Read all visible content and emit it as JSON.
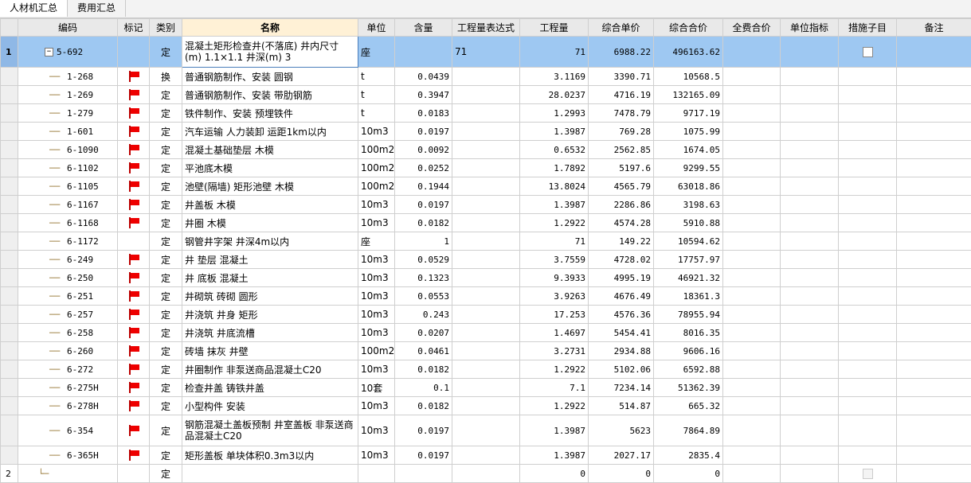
{
  "tabs": [
    "人材机汇总",
    "费用汇总"
  ],
  "headers": [
    "编码",
    "标记",
    "类别",
    "名称",
    "单位",
    "含量",
    "工程量表达式",
    "工程量",
    "综合单价",
    "综合合价",
    "全费合价",
    "单位指标",
    "措施子目",
    "备注"
  ],
  "main_row": {
    "index": "1",
    "code": "5-692",
    "type": "定",
    "name": "混凝土矩形检查井(不落底) 井内尺寸(m) 1.1×1.1 井深(m) 3",
    "unit": "座",
    "qty_expr": "71",
    "quantity": "71",
    "unit_price": "6988.22",
    "total": "496163.62"
  },
  "sub_rows": [
    {
      "code": "1-268",
      "type": "换",
      "name": "普通钢筋制作、安装 圆钢",
      "unit": "t",
      "content": "0.0439",
      "quantity": "3.1169",
      "unit_price": "3390.71",
      "total": "10568.5",
      "flag": true
    },
    {
      "code": "1-269",
      "type": "定",
      "name": "普通钢筋制作、安装 带肋钢筋",
      "unit": "t",
      "content": "0.3947",
      "quantity": "28.0237",
      "unit_price": "4716.19",
      "total": "132165.09",
      "flag": true
    },
    {
      "code": "1-279",
      "type": "定",
      "name": "铁件制作、安装 预埋铁件",
      "unit": "t",
      "content": "0.0183",
      "quantity": "1.2993",
      "unit_price": "7478.79",
      "total": "9717.19",
      "flag": true
    },
    {
      "code": "1-601",
      "type": "定",
      "name": "汽车运输 人力装卸 运距1km以内",
      "unit": "10m3",
      "content": "0.0197",
      "quantity": "1.3987",
      "unit_price": "769.28",
      "total": "1075.99",
      "flag": true
    },
    {
      "code": "6-1090",
      "type": "定",
      "name": "混凝土基础垫层 木模",
      "unit": "100m2",
      "content": "0.0092",
      "quantity": "0.6532",
      "unit_price": "2562.85",
      "total": "1674.05",
      "flag": true
    },
    {
      "code": "6-1102",
      "type": "定",
      "name": "平池底木模",
      "unit": "100m2",
      "content": "0.0252",
      "quantity": "1.7892",
      "unit_price": "5197.6",
      "total": "9299.55",
      "flag": true
    },
    {
      "code": "6-1105",
      "type": "定",
      "name": "池壁(隔墙) 矩形池壁 木模",
      "unit": "100m2",
      "content": "0.1944",
      "quantity": "13.8024",
      "unit_price": "4565.79",
      "total": "63018.86",
      "flag": true
    },
    {
      "code": "6-1167",
      "type": "定",
      "name": "井盖板 木模",
      "unit": "10m3",
      "content": "0.0197",
      "quantity": "1.3987",
      "unit_price": "2286.86",
      "total": "3198.63",
      "flag": true
    },
    {
      "code": "6-1168",
      "type": "定",
      "name": "井圈 木模",
      "unit": "10m3",
      "content": "0.0182",
      "quantity": "1.2922",
      "unit_price": "4574.28",
      "total": "5910.88",
      "flag": true
    },
    {
      "code": "6-1172",
      "type": "定",
      "name": "钢管井字架 井深4m以内",
      "unit": "座",
      "content": "1",
      "quantity": "71",
      "unit_price": "149.22",
      "total": "10594.62",
      "flag": false
    },
    {
      "code": "6-249",
      "type": "定",
      "name": "井 垫层 混凝土",
      "unit": "10m3",
      "content": "0.0529",
      "quantity": "3.7559",
      "unit_price": "4728.02",
      "total": "17757.97",
      "flag": true
    },
    {
      "code": "6-250",
      "type": "定",
      "name": "井 底板 混凝土",
      "unit": "10m3",
      "content": "0.1323",
      "quantity": "9.3933",
      "unit_price": "4995.19",
      "total": "46921.32",
      "flag": true
    },
    {
      "code": "6-251",
      "type": "定",
      "name": "井砌筑 砖砌 圆形",
      "unit": "10m3",
      "content": "0.0553",
      "quantity": "3.9263",
      "unit_price": "4676.49",
      "total": "18361.3",
      "flag": true
    },
    {
      "code": "6-257",
      "type": "定",
      "name": "井浇筑 井身 矩形",
      "unit": "10m3",
      "content": "0.243",
      "quantity": "17.253",
      "unit_price": "4576.36",
      "total": "78955.94",
      "flag": true
    },
    {
      "code": "6-258",
      "type": "定",
      "name": "井浇筑 井底流槽",
      "unit": "10m3",
      "content": "0.0207",
      "quantity": "1.4697",
      "unit_price": "5454.41",
      "total": "8016.35",
      "flag": true
    },
    {
      "code": "6-260",
      "type": "定",
      "name": "砖墙 抹灰 井壁",
      "unit": "100m2",
      "content": "0.0461",
      "quantity": "3.2731",
      "unit_price": "2934.88",
      "total": "9606.16",
      "flag": true
    },
    {
      "code": "6-272",
      "type": "定",
      "name": "井圈制作 非泵送商品混凝土C20",
      "unit": "10m3",
      "content": "0.0182",
      "quantity": "1.2922",
      "unit_price": "5102.06",
      "total": "6592.88",
      "flag": true
    },
    {
      "code": "6-275H",
      "type": "定",
      "name": "检查井盖 铸铁井盖",
      "unit": "10套",
      "content": "0.1",
      "quantity": "7.1",
      "unit_price": "7234.14",
      "total": "51362.39",
      "flag": true
    },
    {
      "code": "6-278H",
      "type": "定",
      "name": "小型构件 安装",
      "unit": "10m3",
      "content": "0.0182",
      "quantity": "1.2922",
      "unit_price": "514.87",
      "total": "665.32",
      "flag": true
    },
    {
      "code": "6-354",
      "type": "定",
      "name": "钢筋混凝土盖板预制 井室盖板 非泵送商品混凝土C20",
      "unit": "10m3",
      "content": "0.0197",
      "quantity": "1.3987",
      "unit_price": "5623",
      "total": "7864.89",
      "flag": true,
      "tall": true
    },
    {
      "code": "6-365H",
      "type": "定",
      "name": "矩形盖板 单块体积0.3m3以内",
      "unit": "10m3",
      "content": "0.0197",
      "quantity": "1.3987",
      "unit_price": "2027.17",
      "total": "2835.4",
      "flag": true
    }
  ],
  "row2": {
    "index": "2",
    "type": "定",
    "quantity": "0",
    "unit_price": "0",
    "total": "0"
  }
}
